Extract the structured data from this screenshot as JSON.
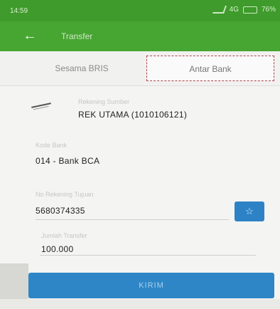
{
  "status_bar": {
    "time": "14:59",
    "network": "4G",
    "battery": "76%"
  },
  "app_bar": {
    "title": "Transfer",
    "back_icon": "arrow-left-icon"
  },
  "tabs": [
    {
      "label": "Sesama BRIS"
    },
    {
      "label": "Antar Bank"
    }
  ],
  "form": {
    "source_account": {
      "label": "Rekening Sumber",
      "value": "REK UTAMA (1010106121)"
    },
    "bank_code": {
      "label": "Kode Bank",
      "value": "014 - Bank BCA"
    },
    "destination_account": {
      "label": "No Rekening Tujuan",
      "value": "5680374335"
    },
    "amount": {
      "label": "Jumlah Transfer",
      "value": "100.000"
    },
    "favorite_icon": "star-icon"
  },
  "send_button": {
    "label": "KIRIM"
  },
  "colors": {
    "status_bar": "#3f9b2c",
    "app_bar": "#47a532",
    "button_blue": "#2e86c6"
  }
}
